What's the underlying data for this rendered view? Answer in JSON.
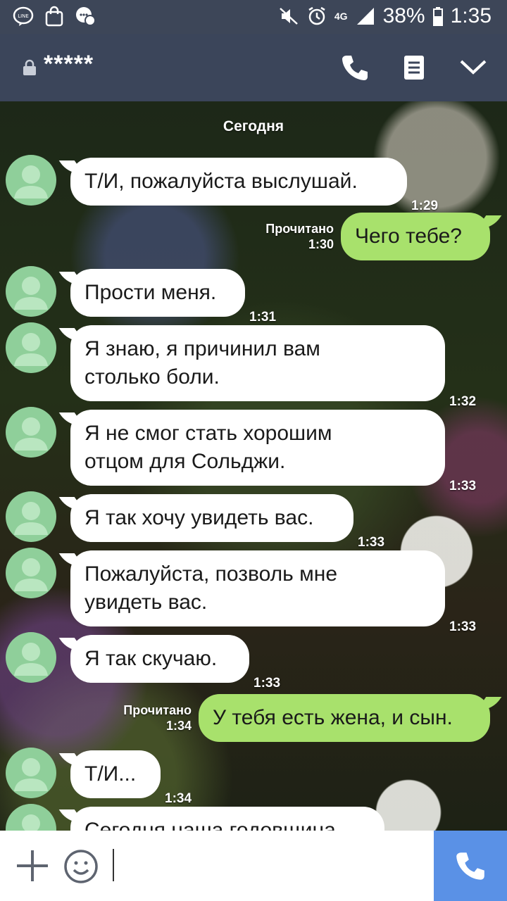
{
  "status_bar": {
    "battery": "38%",
    "time": "1:35",
    "network": "4G",
    "icons": [
      "line-icon",
      "shopping-bag-icon",
      "messenger-icon",
      "mute-icon",
      "alarm-icon",
      "signal-icon",
      "battery-icon"
    ]
  },
  "header": {
    "title": "*****",
    "icons": [
      "lock-icon",
      "phone-icon",
      "notes-icon",
      "chevron-down-icon"
    ],
    "colors": {
      "bar": "#3b455a"
    }
  },
  "chat": {
    "date_label": "Сегодня",
    "messages": [
      {
        "side": "in",
        "lines": [
          "Т/И, пожалуйста выслушай."
        ],
        "time": "1:29"
      },
      {
        "side": "out",
        "lines": [
          "Чего тебе?"
        ],
        "status": "Прочитано",
        "time": "1:30"
      },
      {
        "side": "in",
        "lines": [
          "Прости меня."
        ],
        "time": "1:31"
      },
      {
        "side": "in",
        "lines": [
          "Я знаю, я причинил вам",
          "столько боли."
        ],
        "time": "1:32"
      },
      {
        "side": "in",
        "lines": [
          "Я не смог стать хорошим",
          "отцом для Сольджи."
        ],
        "time": "1:33"
      },
      {
        "side": "in",
        "lines": [
          "Я так хочу увидеть вас."
        ],
        "time": "1:33"
      },
      {
        "side": "in",
        "lines": [
          "Пожалуйста, позволь мне",
          "увидеть вас."
        ],
        "time": "1:33"
      },
      {
        "side": "in",
        "lines": [
          "Я так скучаю."
        ],
        "time": "1:33"
      },
      {
        "side": "out",
        "lines": [
          "У тебя есть жена, и сын."
        ],
        "status": "Прочитано",
        "time": "1:34"
      },
      {
        "side": "in",
        "lines": [
          "Т/И..."
        ],
        "time": "1:34"
      },
      {
        "side": "in",
        "lines": [
          "Сегодня наша годовщина"
        ],
        "time": ""
      }
    ],
    "colors": {
      "incoming": "#ffffff",
      "outgoing": "#a8e16c",
      "avatar": "#8fcf9a"
    }
  },
  "input_bar": {
    "value": "",
    "icons": [
      "plus-icon",
      "emoji-icon",
      "phone-icon"
    ],
    "colors": {
      "call_button": "#5a91e6"
    }
  }
}
